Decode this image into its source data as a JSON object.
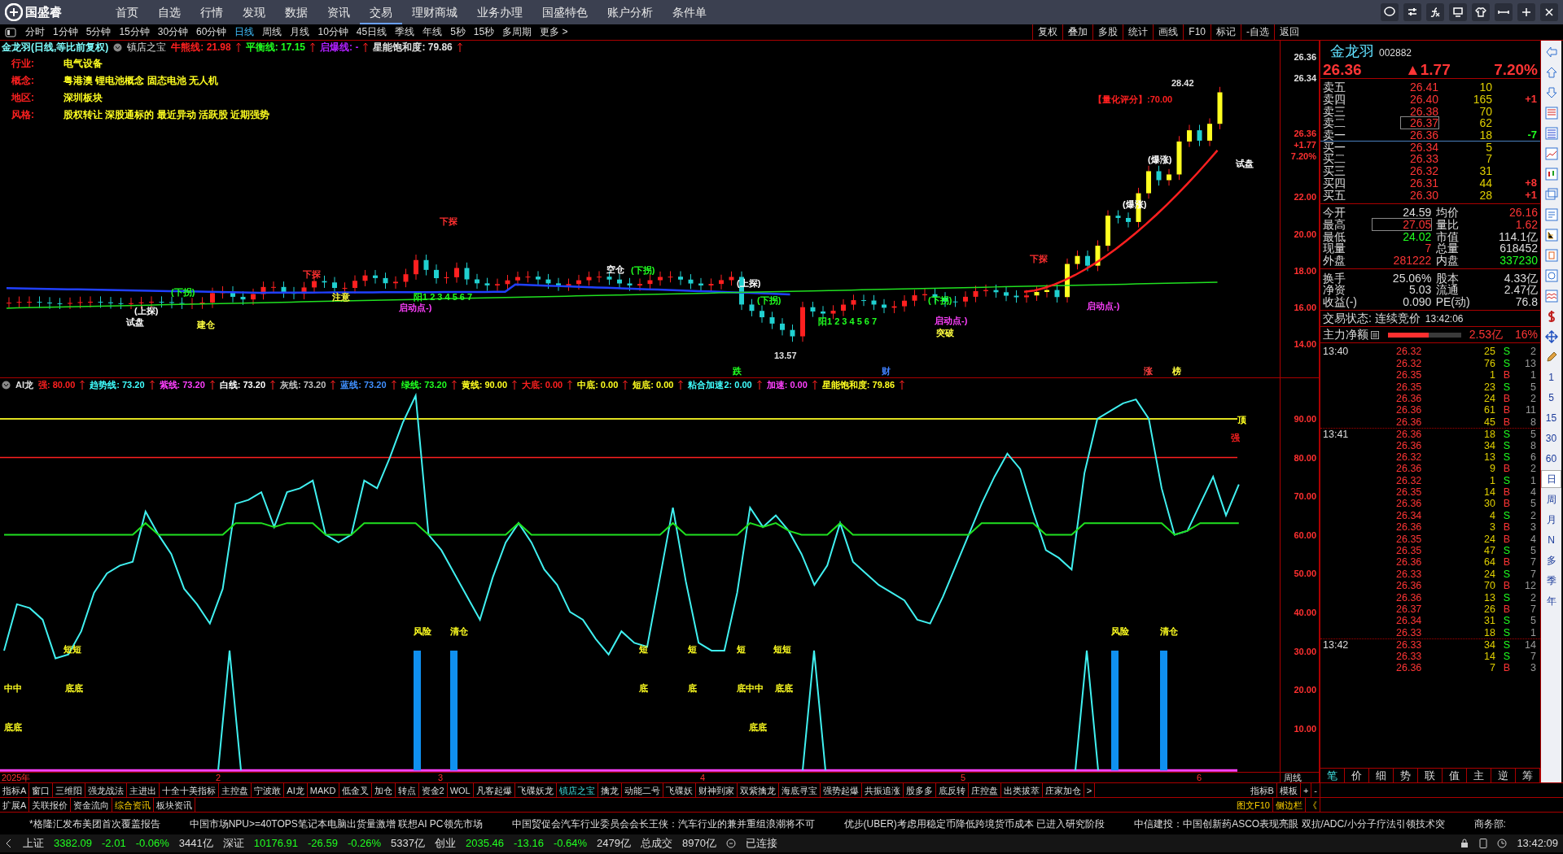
{
  "app": {
    "logo_text": "国盛睿",
    "menu": [
      {
        "label": "首页",
        "selected": false
      },
      {
        "label": "自选",
        "selected": false
      },
      {
        "label": "行情",
        "selected": false
      },
      {
        "label": "发现",
        "selected": false
      },
      {
        "label": "数据",
        "selected": false
      },
      {
        "label": "资讯",
        "selected": false
      },
      {
        "label": "交易",
        "selected": true
      },
      {
        "label": "理财商城",
        "selected": false
      },
      {
        "label": "业务办理",
        "selected": false
      },
      {
        "label": "国盛特色",
        "selected": false
      },
      {
        "label": "账户分析",
        "selected": false
      },
      {
        "label": "条件单",
        "selected": false
      }
    ]
  },
  "periods": [
    {
      "label": "分时",
      "selected": false
    },
    {
      "label": "1分钟",
      "selected": false
    },
    {
      "label": "5分钟",
      "selected": false
    },
    {
      "label": "15分钟",
      "selected": false
    },
    {
      "label": "30分钟",
      "selected": false
    },
    {
      "label": "60分钟",
      "selected": false
    },
    {
      "label": "日线",
      "selected": true
    },
    {
      "label": "周线",
      "selected": false
    },
    {
      "label": "月线",
      "selected": false
    },
    {
      "label": "10分钟",
      "selected": false
    },
    {
      "label": "45日线",
      "selected": false
    },
    {
      "label": "季线",
      "selected": false
    },
    {
      "label": "年线",
      "selected": false
    },
    {
      "label": "5秒",
      "selected": false
    },
    {
      "label": "15秒",
      "selected": false
    },
    {
      "label": "多周期",
      "selected": false
    },
    {
      "label": "更多 >",
      "selected": false
    }
  ],
  "chart_tools": [
    "复权",
    "叠加",
    "多股",
    "统计",
    "画线",
    "F10",
    "标记",
    "-自选",
    "返回"
  ],
  "price_chart": {
    "title": "金龙羽(日线,等比前复权)",
    "indicator": "镇店之宝",
    "legend": [
      {
        "text": "牛熊线: 21.98",
        "color": "#ff2020"
      },
      {
        "text": "平衡线: 17.15",
        "color": "#20ff20"
      },
      {
        "text": "启爆线: -",
        "color": "#b020ff"
      },
      {
        "text": "星能饱和度: 79.86",
        "color": "#e0e0e0"
      }
    ],
    "info": [
      {
        "label": "行业:",
        "value": "电气设备"
      },
      {
        "label": "概念:",
        "value": "粤港澳 锂电池概念 固态电池 无人机"
      },
      {
        "label": "地区:",
        "value": "深圳板块"
      },
      {
        "label": "风格:",
        "value": "股权转让 深股通标的 最近异动 活跃股 近期强势"
      }
    ],
    "axis_labels": [
      {
        "text": "26.36",
        "color": "#e0e0e0"
      },
      {
        "text": "26.34",
        "color": "#e0e0e0"
      },
      {
        "text": "26.36",
        "color": "#ff3030"
      },
      {
        "text": "+1.77",
        "color": "#ff3030"
      },
      {
        "text": "7.20%",
        "color": "#ff3030"
      },
      {
        "text": "22.00",
        "color": "#ff3030"
      },
      {
        "text": "20.00",
        "color": "#ff3030"
      },
      {
        "text": "18.00",
        "color": "#ff3030"
      },
      {
        "text": "16.00",
        "color": "#ff3030"
      },
      {
        "text": "14.00",
        "color": "#ff3030"
      }
    ],
    "annotations": [
      {
        "text": "【量化评分】:70.00",
        "color": "#ff2020"
      },
      {
        "text": "28.42",
        "color": "#e0e0e0"
      },
      {
        "text": "13.57",
        "color": "#e0e0e0"
      },
      {
        "text": "下探",
        "color": "#ff3030"
      },
      {
        "text": "下探",
        "color": "#ff3030"
      },
      {
        "text": "(下拐)",
        "color": "#20ff20"
      },
      {
        "text": "(上探)",
        "color": "#ffffff"
      },
      {
        "text": "试盘",
        "color": "#ffffff"
      },
      {
        "text": "建仓",
        "color": "#ffff40"
      },
      {
        "text": "注意",
        "color": "#ffff40"
      },
      {
        "text": "阳1 2 3 4 5 6 7",
        "color": "#20ff20"
      },
      {
        "text": "启动点-)",
        "color": "#ff40ff"
      },
      {
        "text": "空仓",
        "color": "#ffffff"
      },
      {
        "text": "(下拐)",
        "color": "#20ff20"
      },
      {
        "text": "(上探)",
        "color": "#ffffff"
      },
      {
        "text": "(下拐)",
        "color": "#20ff20"
      },
      {
        "text": "阳1 2 3 4 5 6 7",
        "color": "#20ff20"
      },
      {
        "text": "(下拐)",
        "color": "#20ff20"
      },
      {
        "text": "启动点-)",
        "color": "#ff40ff"
      },
      {
        "text": "下探",
        "color": "#ff3030"
      },
      {
        "text": "启动点-)",
        "color": "#ff40ff"
      },
      {
        "text": "(爆涨)",
        "color": "#ffffff"
      },
      {
        "text": "(爆涨)",
        "color": "#ffffff"
      },
      {
        "text": "试盘",
        "color": "#ffffff"
      },
      {
        "text": "突破",
        "color": "#ffff40"
      },
      {
        "text": "跌",
        "color": "#20ff20"
      },
      {
        "text": "财",
        "color": "#4080ff"
      },
      {
        "text": "涨",
        "color": "#ff4040"
      },
      {
        "text": "榜",
        "color": "#ffff40"
      }
    ]
  },
  "indicator_chart": {
    "name": "AI龙",
    "legend": [
      {
        "text": "强: 80.00",
        "color": "#ff2020"
      },
      {
        "text": "趋势线: 73.20",
        "color": "#40ffff"
      },
      {
        "text": "紫线: 73.20",
        "color": "#ff40ff"
      },
      {
        "text": "白线: 73.20",
        "color": "#ffffff"
      },
      {
        "text": "灰线: 73.20",
        "color": "#c0c0c0"
      },
      {
        "text": "蓝线: 73.20",
        "color": "#4090ff"
      },
      {
        "text": "绿线: 73.20",
        "color": "#20ff20"
      },
      {
        "text": "黄线: 90.00",
        "color": "#ffff20"
      },
      {
        "text": "大底: 0.00",
        "color": "#ff2020"
      },
      {
        "text": "中底: 0.00",
        "color": "#ffff20"
      },
      {
        "text": "短底: 0.00",
        "color": "#ffff20"
      },
      {
        "text": "粘合加速2: 0.00",
        "color": "#40ffff"
      },
      {
        "text": "加速: 0.00",
        "color": "#ff40ff"
      },
      {
        "text": "星能饱和度: 79.86",
        "color": "#ffff20"
      }
    ],
    "axis_labels": [
      "90.00",
      "80.00",
      "70.00",
      "60.00",
      "50.00",
      "40.00",
      "30.00",
      "20.00",
      "10.00"
    ],
    "annotations": [
      {
        "text": "风险",
        "color": "#ffff20"
      },
      {
        "text": "清仓",
        "color": "#ffff20"
      },
      {
        "text": "风险",
        "color": "#ffff20"
      },
      {
        "text": "清仓",
        "color": "#ffff20"
      },
      {
        "text": "顶",
        "color": "#ffff20"
      },
      {
        "text": "强",
        "color": "#ff2020"
      },
      {
        "text": "短短",
        "color": "#ffff20"
      },
      {
        "text": "中中",
        "color": "#ffff20"
      },
      {
        "text": "底底",
        "color": "#ffff20"
      },
      {
        "text": "底底",
        "color": "#ffff20"
      },
      {
        "text": "短",
        "color": "#ffff20"
      },
      {
        "text": "短",
        "color": "#ffff20"
      },
      {
        "text": "短",
        "color": "#ffff20"
      },
      {
        "text": "短短",
        "color": "#ffff20"
      },
      {
        "text": "底",
        "color": "#ffff20"
      },
      {
        "text": "底",
        "color": "#ffff20"
      },
      {
        "text": "底中中",
        "color": "#ffff20"
      },
      {
        "text": "底底",
        "color": "#ffff20"
      },
      {
        "text": "底底",
        "color": "#ffff20"
      }
    ],
    "date_labels": [
      "2025年",
      "2",
      "3",
      "4",
      "5",
      "6"
    ],
    "period_label": "周线"
  },
  "quote": {
    "name": "金龙羽",
    "code": "002882",
    "price": "26.36",
    "change": "▲1.77",
    "percent": "7.20%",
    "order_book": [
      {
        "label": "卖五",
        "price": "26.41",
        "volume": "10",
        "boxed": false
      },
      {
        "label": "卖四",
        "price": "26.40",
        "volume": "165",
        "delta": "+1",
        "color": "#ff3535",
        "boxed": false
      },
      {
        "label": "卖三",
        "price": "26.38",
        "volume": "70",
        "boxed": false
      },
      {
        "label": "卖二",
        "price": "26.37",
        "volume": "62",
        "boxed": true
      },
      {
        "label": "卖一",
        "price": "26.36",
        "volume": "18",
        "delta": "-7",
        "color": "#20ff20",
        "boxed": false
      },
      {
        "label": "买一",
        "price": "26.34",
        "volume": "5",
        "boxed": false
      },
      {
        "label": "买二",
        "price": "26.33",
        "volume": "7",
        "boxed": false
      },
      {
        "label": "买三",
        "price": "26.32",
        "volume": "31",
        "boxed": false
      },
      {
        "label": "买四",
        "price": "26.31",
        "volume": "44",
        "delta": "+8",
        "color": "#ff3535",
        "boxed": false
      },
      {
        "label": "买五",
        "price": "26.30",
        "volume": "28",
        "delta": "+1",
        "color": "#ff3535",
        "boxed": false
      }
    ],
    "stats": [
      [
        {
          "label": "今开",
          "value": "24.59",
          "color": "#dddddd",
          "boxed": false
        },
        {
          "label": "均价",
          "value": "26.16",
          "color": "#ff3535",
          "boxed": false
        }
      ],
      [
        {
          "label": "最高",
          "value": "27.05",
          "color": "#ff3535",
          "boxed": true
        },
        {
          "label": "量比",
          "value": "1.62",
          "color": "#ff3535",
          "boxed": false
        }
      ],
      [
        {
          "label": "最低",
          "value": "24.02",
          "color": "#20ff20",
          "boxed": false
        },
        {
          "label": "市值",
          "value": "114.1亿",
          "color": "#dddddd",
          "boxed": false
        }
      ],
      [
        {
          "label": "现量",
          "value": "7",
          "color": "#ff3535",
          "boxed": false
        },
        {
          "label": "总量",
          "value": "618452",
          "color": "#dddddd",
          "boxed": false
        }
      ],
      [
        {
          "label": "外盘",
          "value": "281222",
          "color": "#ff3535",
          "boxed": false
        },
        {
          "label": "内盘",
          "value": "337230",
          "color": "#20ff20",
          "boxed": false
        }
      ]
    ],
    "stats2": [
      [
        {
          "label": "换手",
          "value": "25.06%"
        },
        {
          "label": "股本",
          "value": "4.33亿"
        }
      ],
      [
        {
          "label": "净资",
          "value": "5.03"
        },
        {
          "label": "流通",
          "value": "2.47亿"
        }
      ],
      [
        {
          "label": "收益(-)",
          "value": "0.090"
        },
        {
          "label": "PE(动)",
          "value": "76.8"
        }
      ]
    ],
    "trade_status": "交易状态: 连续竞价",
    "trade_time": "13:42:06",
    "main_flow": {
      "label": "主力净额",
      "level": 0.55,
      "value": "2.53亿",
      "percent": "16%"
    },
    "trades": [
      {
        "time": "13:40",
        "price": "26.32",
        "volume": "25",
        "side": "S",
        "kind": "sell",
        "count": "2"
      },
      {
        "price": "26.32",
        "volume": "76",
        "side": "S",
        "kind": "sell",
        "count": "13"
      },
      {
        "price": "26.35",
        "volume": "1",
        "side": "B",
        "kind": "buy",
        "count": "1"
      },
      {
        "price": "26.35",
        "volume": "23",
        "side": "S",
        "kind": "sell",
        "count": "5"
      },
      {
        "price": "26.36",
        "volume": "24",
        "side": "B",
        "kind": "buy",
        "count": "2"
      },
      {
        "price": "26.36",
        "volume": "61",
        "side": "B",
        "kind": "buy",
        "count": "11"
      },
      {
        "price": "26.36",
        "volume": "45",
        "side": "B",
        "kind": "buy",
        "count": "8"
      },
      {
        "time": "13:41",
        "price": "26.36",
        "volume": "18",
        "side": "S",
        "kind": "sell",
        "count": "5"
      },
      {
        "price": "26.36",
        "volume": "34",
        "side": "S",
        "kind": "sell",
        "count": "8"
      },
      {
        "price": "26.32",
        "volume": "13",
        "side": "S",
        "kind": "sell",
        "count": "6"
      },
      {
        "price": "26.36",
        "volume": "9",
        "side": "B",
        "kind": "buy",
        "count": "2"
      },
      {
        "price": "26.32",
        "volume": "1",
        "side": "S",
        "kind": "sell",
        "count": "1"
      },
      {
        "price": "26.35",
        "volume": "14",
        "side": "B",
        "kind": "buy",
        "count": "4"
      },
      {
        "price": "26.36",
        "volume": "30",
        "side": "B",
        "kind": "buy",
        "count": "5"
      },
      {
        "price": "26.34",
        "volume": "4",
        "side": "S",
        "kind": "sell",
        "count": "2"
      },
      {
        "price": "26.36",
        "volume": "3",
        "side": "B",
        "kind": "buy",
        "count": "3"
      },
      {
        "price": "26.35",
        "volume": "24",
        "side": "B",
        "kind": "buy",
        "count": "4"
      },
      {
        "price": "26.35",
        "volume": "47",
        "side": "S",
        "kind": "sell",
        "count": "5"
      },
      {
        "price": "26.36",
        "volume": "64",
        "side": "B",
        "kind": "buy",
        "count": "7"
      },
      {
        "price": "26.33",
        "volume": "24",
        "side": "S",
        "kind": "sell",
        "count": "7"
      },
      {
        "price": "26.36",
        "volume": "70",
        "side": "B",
        "kind": "buy",
        "count": "12"
      },
      {
        "price": "26.36",
        "volume": "13",
        "side": "S",
        "kind": "sell",
        "count": "2"
      },
      {
        "price": "26.37",
        "volume": "26",
        "side": "B",
        "kind": "buy",
        "count": "7"
      },
      {
        "price": "26.34",
        "volume": "31",
        "side": "S",
        "kind": "sell",
        "count": "5"
      },
      {
        "price": "26.33",
        "volume": "18",
        "side": "S",
        "kind": "sell",
        "count": "1"
      },
      {
        "time": "13:42",
        "price": "26.33",
        "volume": "34",
        "side": "S",
        "kind": "sell",
        "count": "14"
      },
      {
        "price": "26.33",
        "volume": "14",
        "side": "S",
        "kind": "sell",
        "count": "7"
      },
      {
        "price": "26.36",
        "volume": "7",
        "side": "B",
        "kind": "buy",
        "count": "3"
      }
    ],
    "panel_tabs": [
      {
        "label": "笔",
        "selected": true
      },
      {
        "label": "价",
        "selected": false
      },
      {
        "label": "细",
        "selected": false
      },
      {
        "label": "势",
        "selected": false
      },
      {
        "label": "联",
        "selected": false
      },
      {
        "label": "值",
        "selected": false
      },
      {
        "label": "主",
        "selected": false
      },
      {
        "label": "逆",
        "selected": false
      },
      {
        "label": "筹",
        "selected": false
      }
    ]
  },
  "side_strip": {
    "periods": [
      {
        "label": "1",
        "selected": false
      },
      {
        "label": "5",
        "selected": false
      },
      {
        "label": "15",
        "selected": false
      },
      {
        "label": "30",
        "selected": false
      },
      {
        "label": "60",
        "selected": false
      },
      {
        "label": "日",
        "selected": true
      },
      {
        "label": "周",
        "selected": false
      },
      {
        "label": "月",
        "selected": false
      },
      {
        "label": "N",
        "selected": false
      },
      {
        "label": "多",
        "selected": false
      },
      {
        "label": "季",
        "selected": false
      },
      {
        "label": "年",
        "selected": false
      }
    ]
  },
  "indicator_tabs": [
    {
      "label": "指标A",
      "selected": false
    },
    {
      "label": "窗口",
      "selected": false
    },
    {
      "label": "三维阳",
      "selected": false
    },
    {
      "label": "强龙战法",
      "selected": false
    },
    {
      "label": "主进出",
      "selected": false
    },
    {
      "label": "十全十美指标",
      "selected": false
    },
    {
      "label": "主控盘",
      "selected": false
    },
    {
      "label": "宁波敢",
      "selected": false
    },
    {
      "label": "AI龙",
      "selected": false
    },
    {
      "label": "MAKD",
      "selected": false
    },
    {
      "label": "低金叉",
      "selected": false
    },
    {
      "label": "加仓",
      "selected": false
    },
    {
      "label": "转点",
      "selected": false
    },
    {
      "label": "资金2",
      "selected": false
    },
    {
      "label": "WOL",
      "selected": false
    },
    {
      "label": "凡客起爆",
      "selected": false
    },
    {
      "label": "飞碟妖龙",
      "selected": false
    },
    {
      "label": "镇店之宝",
      "selected": true
    },
    {
      "label": "擒龙",
      "selected": false
    },
    {
      "label": "动能二号",
      "selected": false
    },
    {
      "label": "飞碟妖",
      "selected": false
    },
    {
      "label": "财神到家",
      "selected": false
    },
    {
      "label": "双紫擒龙",
      "selected": false
    },
    {
      "label": "海底寻宝",
      "selected": false
    },
    {
      "label": "强势起爆",
      "selected": false
    },
    {
      "label": "共振追涨",
      "selected": false
    },
    {
      "label": "股多多",
      "selected": false
    },
    {
      "label": "底反转",
      "selected": false
    },
    {
      "label": "庄控盘",
      "selected": false
    },
    {
      "label": "出类拔萃",
      "selected": false
    },
    {
      "label": "庄家加仓",
      "selected": false
    },
    {
      "label": ">",
      "selected": false
    }
  ],
  "indicator_tabs_right": [
    "指标B",
    "模板",
    "+",
    "-"
  ],
  "info_tabs": [
    {
      "label": "扩展A",
      "selected": false
    },
    {
      "label": "关联报价",
      "selected": false
    },
    {
      "label": "资金流向",
      "selected": false
    },
    {
      "label": "综合资讯",
      "selected": true
    },
    {
      "label": "板块资讯",
      "selected": false
    }
  ],
  "info_tabs_right": [
    "图文F10",
    "侧边栏",
    "《"
  ],
  "news": [
    "*格隆汇发布美团首次覆盖报告",
    "中国市场NPU>=40TOPS笔记本电脑出货量激增 联想AI PC领先市场",
    "中国贸促会汽车行业委员会会长王侠：汽车行业的兼并重组浪潮将不可",
    "优步(UBER)考虑用稳定币降低跨境货币成本 已进入研究阶段",
    "中信建投：中国创新药ASCO表现亮眼 双抗/ADC/小分子疗法引领技术突",
    "商务部:"
  ],
  "status_bar": {
    "indices": [
      {
        "name": "上证",
        "value": "3382.09",
        "change": "-2.01",
        "percent": "-0.06%",
        "amount": "3441亿"
      },
      {
        "name": "深证",
        "value": "10176.91",
        "change": "-26.59",
        "percent": "-0.26%",
        "amount": "5337亿"
      },
      {
        "name": "创业",
        "value": "2035.46",
        "change": "-13.16",
        "percent": "-0.64%",
        "amount": "2479亿"
      }
    ],
    "total_label": "总成交",
    "total": "8970亿",
    "connection": "已连接",
    "time": "13:42:09"
  }
}
